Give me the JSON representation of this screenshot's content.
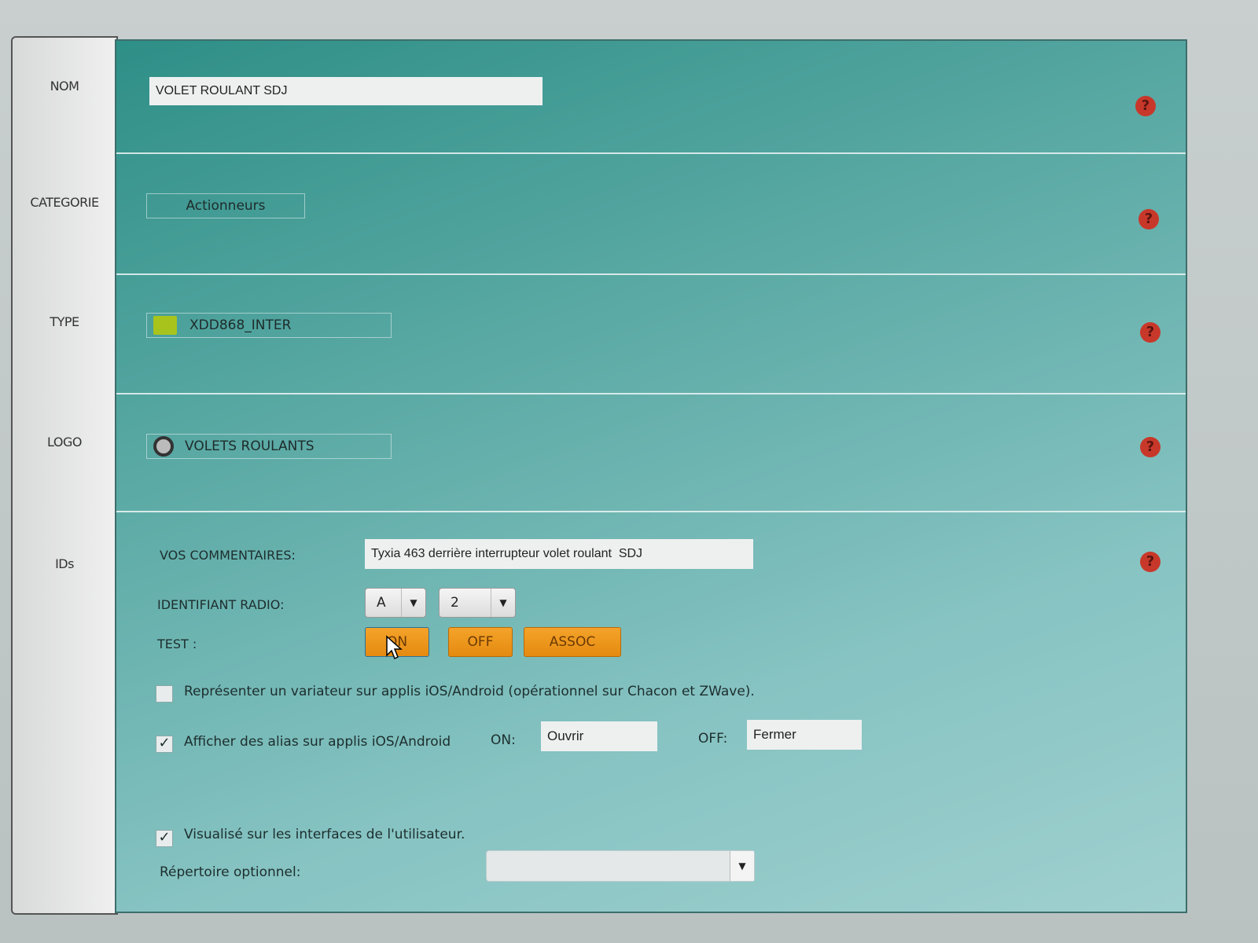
{
  "sidebar": {
    "items": [
      {
        "label": "NOM"
      },
      {
        "label": "CATEGORIE"
      },
      {
        "label": "TYPE"
      },
      {
        "label": "LOGO"
      },
      {
        "label": "IDs"
      }
    ]
  },
  "nom": {
    "value": "VOLET ROULANT SDJ"
  },
  "categorie": {
    "value": "Actionneurs"
  },
  "type": {
    "value": "XDD868_INTER",
    "icon": "green-module-icon"
  },
  "logo": {
    "value": "VOLETS ROULANTS",
    "icon": "shutter-logo-icon"
  },
  "help": {
    "symbol": "?",
    "color": "#c8382a"
  },
  "ids": {
    "comment_label": "VOS COMMENTAIRES:",
    "comment_value": "Tyxia 463 derrière interrupteur volet roulant  SDJ",
    "radio_label": "IDENTIFIANT RADIO:",
    "radio_letter": "A",
    "radio_number": "2",
    "test_label": "TEST :",
    "btn_on": "ON",
    "btn_off": "OFF",
    "btn_assoc": "ASSOC",
    "variateur_label": "Représenter un variateur sur applis iOS/Android (opérationnel sur Chacon et ZWave).",
    "variateur_checked": false,
    "alias_label": "Afficher des alias sur applis iOS/Android",
    "alias_checked": true,
    "alias_on_label": "ON:",
    "alias_on_value": "Ouvrir",
    "alias_off_label": "OFF:",
    "alias_off_value": "Fermer",
    "visible_label": "Visualisé sur les interfaces de l'utilisateur.",
    "visible_checked": true,
    "repertoire_label": "Répertoire optionnel:",
    "repertoire_value": "",
    "check_mark": "✓",
    "dropdown_arrow": "▼"
  },
  "colors": {
    "accent_button": "#f09a1e",
    "panel": "#5aa9a4"
  }
}
